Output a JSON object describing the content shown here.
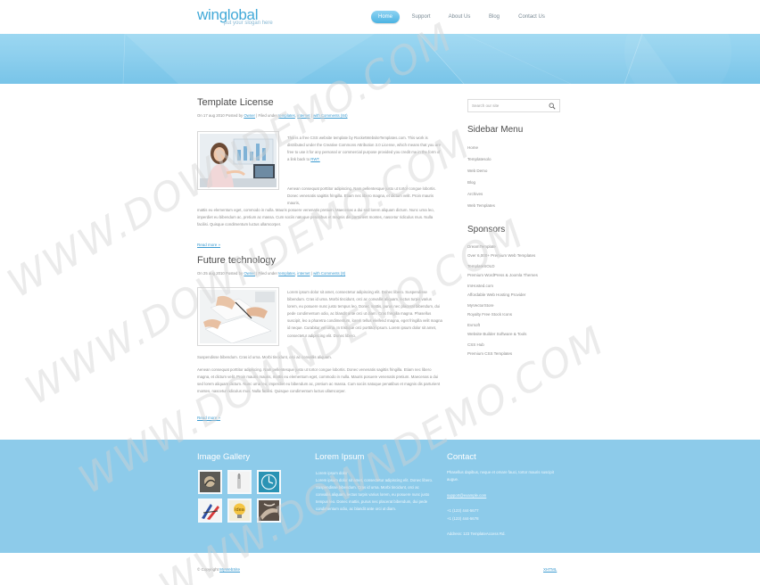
{
  "header": {
    "logo_main": "winglobal",
    "logo_slogan": "put your slogan here",
    "nav": [
      "Home",
      "Support",
      "About Us",
      "Blog",
      "Contact Us"
    ]
  },
  "posts": [
    {
      "title": "Template License",
      "meta_prefix": "On 17 aug 2010 Posted by",
      "author": "Owner",
      "meta_filed": "| Filed under",
      "tag1": "templates",
      "tag2": "internet",
      "comments": "with Comments (84)",
      "para1": "This is a free CSS website template by RocketWebsiteTemplates.com. This work is distributed under the Creative Commons Attribution 3.0 License, which means that you are free to use it for any personal or commercial purpose provided you credit me in the form of a link back to",
      "para1_link": "RWT.",
      "para2_right": "Aenean consequat porttitor adipiscing. Nam pellentesque justo ut tortor congue lobortis. Donec venenatis sagittis fringilla. Etiam nec libero magna, et dictum velit. Proin mauris mauris,",
      "para2_full": "mattis eu elementum eget, commodo in nulla. Mauris posuere venenatis pretium. Maecenas a dui sed lorem aliquam dictum. Nunc urna leo, imperdiet eu bibendum ac, pretium ac massa. Cum sociis natoque penatibus et magnis dis parturient montes, nascetur ridiculus mus. Nulla facilisi. Quisque condimentum luctus ullamcorper.",
      "read_more": "Read more »"
    },
    {
      "title": "Future technology",
      "meta_prefix": "On 25 aug 2010 Posted by",
      "author": "Owner",
      "meta_filed": "| Filed under",
      "tag1": "templates",
      "tag2": "internet",
      "comments": "with Comments (8)",
      "para1": "Lorem ipsum dolor sit amet, consectetur adipiscing elit. Donec libero. Suspendisse bibendum. Cras id urna. Morbi tincidunt, orci ac convallis aliquam, lectus turpis varius lorem, eu posuere nunc justo tempus leo. Donec mattis, purus nec placerat bibendum, dui pede condimentum odio, ac blandit ante orci ut diam. Cras fringilla magna. Phasellus suscipit, leo a pharetra condimentum, lorem tellus eleifend magna, eget fringilla velit magna id neque. Curabitur vel urna. In tristique orci porttitor ipsum. Lorem ipsum dolor sit amet, consectetur adipiscing elit. Donec libero.",
      "para1_tail": "Suspendisse bibendum. Cras id urna. Morbi tincidunt, orci ac convallis aliquam.",
      "para2_full": "Aenean consequat porttitor adipiscing. Nam pellentesque justo ut tortor congue lobortis. Donec venenatis sagittis fringilla. Etiam nec libero magna, et dictum velit. Proin mauris mauris, mattis eu elementum eget, commodo in nulla. Mauris posuere venenatis pretium. Maecenas a dui sed lorem aliquam dictum. Nunc urna leo, imperdiet eu bibendum ac, pretium ac massa. Cum sociis natoque penatibus et magnis dis parturient montes, nascetur ridiculus mus. Nulla facilisi. Quisque condimentum luctus ullamcorper.",
      "read_more": "Read more »"
    }
  ],
  "sidebar": {
    "search_placeholder": "Search our site",
    "menu_title": "Sidebar Menu",
    "menu": [
      "Home",
      "Templatesolo",
      "Web Demo",
      "Blog",
      "Archives",
      "Web Templates"
    ],
    "sponsors_title": "Sponsors",
    "sponsors": [
      {
        "name": "DreamTemplate",
        "desc": "Over 6,000+ Premium Web Templates"
      },
      {
        "name": "TemplateSOLD",
        "desc": "Premium WordPress & Joomla Themes"
      },
      {
        "name": "ImHosted.com",
        "desc": "Affordable Web Hosting Provider"
      },
      {
        "name": "MyVectorStore",
        "desc": "Royalty Free Stock Icons"
      },
      {
        "name": "Evrsoft",
        "desc": "Website Builder Software & Tools"
      },
      {
        "name": "CSS Hub",
        "desc": "Premium CSS Templates"
      }
    ]
  },
  "footer": {
    "gallery_title": "Image Gallery",
    "lorem_title": "Lorem Ipsum",
    "lorem_head": "Lorem ipsum dolor",
    "lorem_text": "Lorem ipsum dolor sit amet, consectetur adipiscing elit. Donec libero. Suspendisse bibendum. Cras id urna. Morbi tincidunt, orci ac convallis aliquam, lectus turpis varius lorem, eu posuere nunc justo tempus leo. Donec mattis, purus nec placerat bibendum, dui pede condimentum odio, ac blandit ante orci ut diam.",
    "contact_title": "Contact",
    "contact_text": "Phasellus dapibus, neque et ornare fauci, tortor mauris suscipit augue.",
    "email": "support@example.com",
    "phone1": "+1 (123) 444-5677",
    "phone2": "+1 (123) 444-5678",
    "address": "Address: 123 TemplateAccess Rd."
  },
  "bottom": {
    "copyright": "© Copyright",
    "company": "MyWebSite",
    "validate": "XHTML"
  },
  "colors": {
    "accent": "#42a9d8",
    "footer_bg": "#8dcbea",
    "banner": "#8fd0ee"
  }
}
